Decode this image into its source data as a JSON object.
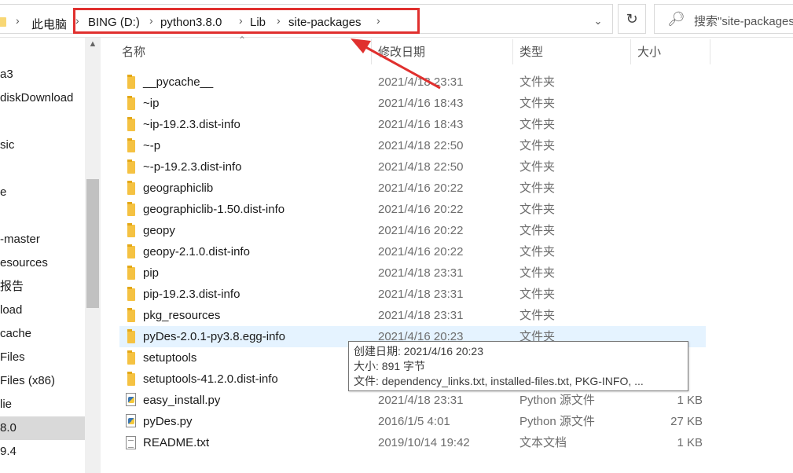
{
  "address": {
    "crumbs": [
      "此电脑",
      "BING (D:)",
      "python3.8.0",
      "Lib",
      "site-packages"
    ],
    "search_placeholder": "搜索\"site-packages\""
  },
  "nav": {
    "items": [
      "a3",
      "diskDownload",
      "sic",
      "e",
      "-master",
      "esources",
      "报告",
      "load",
      "cache",
      "Files",
      "Files (x86)",
      "lie",
      "8.0",
      "9.4"
    ],
    "selected_index": 12
  },
  "columns": {
    "name": "名称",
    "date": "修改日期",
    "type": "类型",
    "size": "大小"
  },
  "files": [
    {
      "name": "__pycache__",
      "date": "2021/4/18 23:31",
      "type": "文件夹",
      "size": "",
      "icon": "folder"
    },
    {
      "name": "~ip",
      "date": "2021/4/16 18:43",
      "type": "文件夹",
      "size": "",
      "icon": "folder"
    },
    {
      "name": "~ip-19.2.3.dist-info",
      "date": "2021/4/16 18:43",
      "type": "文件夹",
      "size": "",
      "icon": "folder"
    },
    {
      "name": "~-p",
      "date": "2021/4/18 22:50",
      "type": "文件夹",
      "size": "",
      "icon": "folder"
    },
    {
      "name": "~-p-19.2.3.dist-info",
      "date": "2021/4/18 22:50",
      "type": "文件夹",
      "size": "",
      "icon": "folder"
    },
    {
      "name": "geographiclib",
      "date": "2021/4/16 20:22",
      "type": "文件夹",
      "size": "",
      "icon": "folder"
    },
    {
      "name": "geographiclib-1.50.dist-info",
      "date": "2021/4/16 20:22",
      "type": "文件夹",
      "size": "",
      "icon": "folder"
    },
    {
      "name": "geopy",
      "date": "2021/4/16 20:22",
      "type": "文件夹",
      "size": "",
      "icon": "folder"
    },
    {
      "name": "geopy-2.1.0.dist-info",
      "date": "2021/4/16 20:22",
      "type": "文件夹",
      "size": "",
      "icon": "folder"
    },
    {
      "name": "pip",
      "date": "2021/4/18 23:31",
      "type": "文件夹",
      "size": "",
      "icon": "folder"
    },
    {
      "name": "pip-19.2.3.dist-info",
      "date": "2021/4/18 23:31",
      "type": "文件夹",
      "size": "",
      "icon": "folder"
    },
    {
      "name": "pkg_resources",
      "date": "2021/4/18 23:31",
      "type": "文件夹",
      "size": "",
      "icon": "folder"
    },
    {
      "name": "pyDes-2.0.1-py3.8.egg-info",
      "date": "2021/4/16 20:23",
      "type": "文件夹",
      "size": "",
      "icon": "folder"
    },
    {
      "name": "setuptools",
      "date": "",
      "type": "",
      "size": "",
      "icon": "folder"
    },
    {
      "name": "setuptools-41.2.0.dist-info",
      "date": "",
      "type": "",
      "size": "",
      "icon": "folder"
    },
    {
      "name": "easy_install.py",
      "date": "2021/4/18 23:31",
      "type": "Python 源文件",
      "size": "1 KB",
      "icon": "python"
    },
    {
      "name": "pyDes.py",
      "date": "2016/1/5 4:01",
      "type": "Python 源文件",
      "size": "27 KB",
      "icon": "python"
    },
    {
      "name": "README.txt",
      "date": "2019/10/14 19:42",
      "type": "文本文档",
      "size": "1 KB",
      "icon": "text"
    }
  ],
  "hover_index": 12,
  "tooltip": {
    "created": "创建日期: 2021/4/16 20:23",
    "size": "大小: 891 字节",
    "files": "文件: dependency_links.txt, installed-files.txt, PKG-INFO, ..."
  },
  "colors": {
    "annotation": "#e0302e",
    "hover_row": "#e5f3ff",
    "folder": "#f5c242"
  }
}
